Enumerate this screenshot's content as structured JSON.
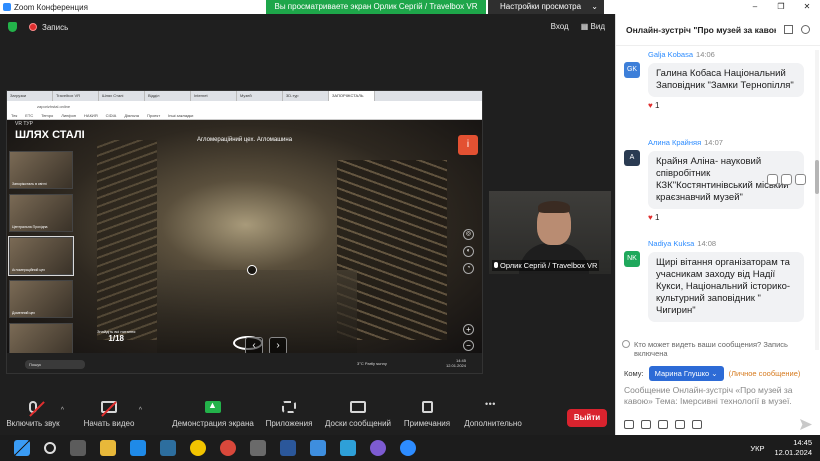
{
  "window": {
    "title": "Zoom Конференция",
    "share_banner": "Вы просматриваете экран Орлик Сергій / Travelbox VR",
    "view_options": "Настройки просмотра",
    "controls": [
      "–",
      "❐",
      "✕"
    ]
  },
  "meeting": {
    "recording_label": "Запись",
    "top_links": [
      "Вход",
      "Вид"
    ]
  },
  "shared_screen": {
    "browser_tabs": [
      "Загрузки",
      "Travelbox VR",
      "Шлях Сталі",
      "Відділ",
      "Internet",
      "Музей",
      "3D-тур",
      "ЗАПОРІЖСТАЛЬ"
    ],
    "url": "zaporizhstal.online",
    "bookmarks": [
      "Тек",
      "ЕТС",
      "Tempo",
      "Линфон",
      "НАКИЯ",
      "CIDIA",
      "Діяльна",
      "Проект",
      "Інші закладки"
    ],
    "tour_label": "VR ТУР",
    "tour_title": "ШЛЯХ СТАЛІ",
    "scene_caption": "Агломераційний цех. Агломашина",
    "thumbnails": [
      "Запоріжсталь в світлі",
      "Центральна Прохідна",
      "Агломераційний цех",
      "Доменний цех",
      ""
    ],
    "counter_label": "Знайдіть всі питання",
    "counter_value": "1/18",
    "info_button": "i",
    "taskbar_search": "Пошук",
    "weather": "3°C  Partly sunny",
    "clock_time": "14:45",
    "clock_date": "12.01.2024"
  },
  "participant": {
    "name": "Орлик Сергій / Travelbox VR"
  },
  "toolbar": {
    "mute_label": "Включить звук",
    "video_label": "Начать видео",
    "share_label": "Демонстрация экрана",
    "apps_label": "Приложения",
    "whiteboard_label": "Доски сообщений",
    "notes_label": "Примечания",
    "more_label": "Дополнительно",
    "leave_label": "Выйти"
  },
  "chat": {
    "header": "Онлайн-зустріч \"Про музей за кавою\"",
    "messages": [
      {
        "author": "Galja Kobasa",
        "time": "14:06",
        "initials": "GK",
        "text": "Галина Кобаса Національний Заповідник \"Замки Тернопілля\"",
        "reaction_count": "1"
      },
      {
        "author": "Алина Крайняя",
        "time": "14:07",
        "initials": "A",
        "text": "Крайня Аліна- науковий співробітник КЗК\"Костянтинівський міський краєзнавчий музей\"",
        "reaction_count": "1"
      },
      {
        "author": "Nadiya Kuksa",
        "time": "14:08",
        "initials": "NK",
        "text": "Щирі вітання організаторам та учасникам заходу від Надії Кукси, Національний історико-культурний заповідник \" Чигирин\""
      }
    ],
    "notice": "Кто может видеть ваши сообщения? Запись включена",
    "to_label": "Кому:",
    "recipient": "Марина Глушко",
    "private_label": "(Личное сообщение)",
    "input_placeholder": "Сообщение Онлайн-зустріч «Про музей за кавою» Тема: Імерсивні технології в музеї."
  },
  "os_taskbar": {
    "language": "УКР",
    "time": "14:45",
    "date": "12.01.2024"
  },
  "colors": {
    "accent_green": "#23b24a",
    "leave_red": "#d9232e",
    "link_blue": "#2d8cff"
  }
}
